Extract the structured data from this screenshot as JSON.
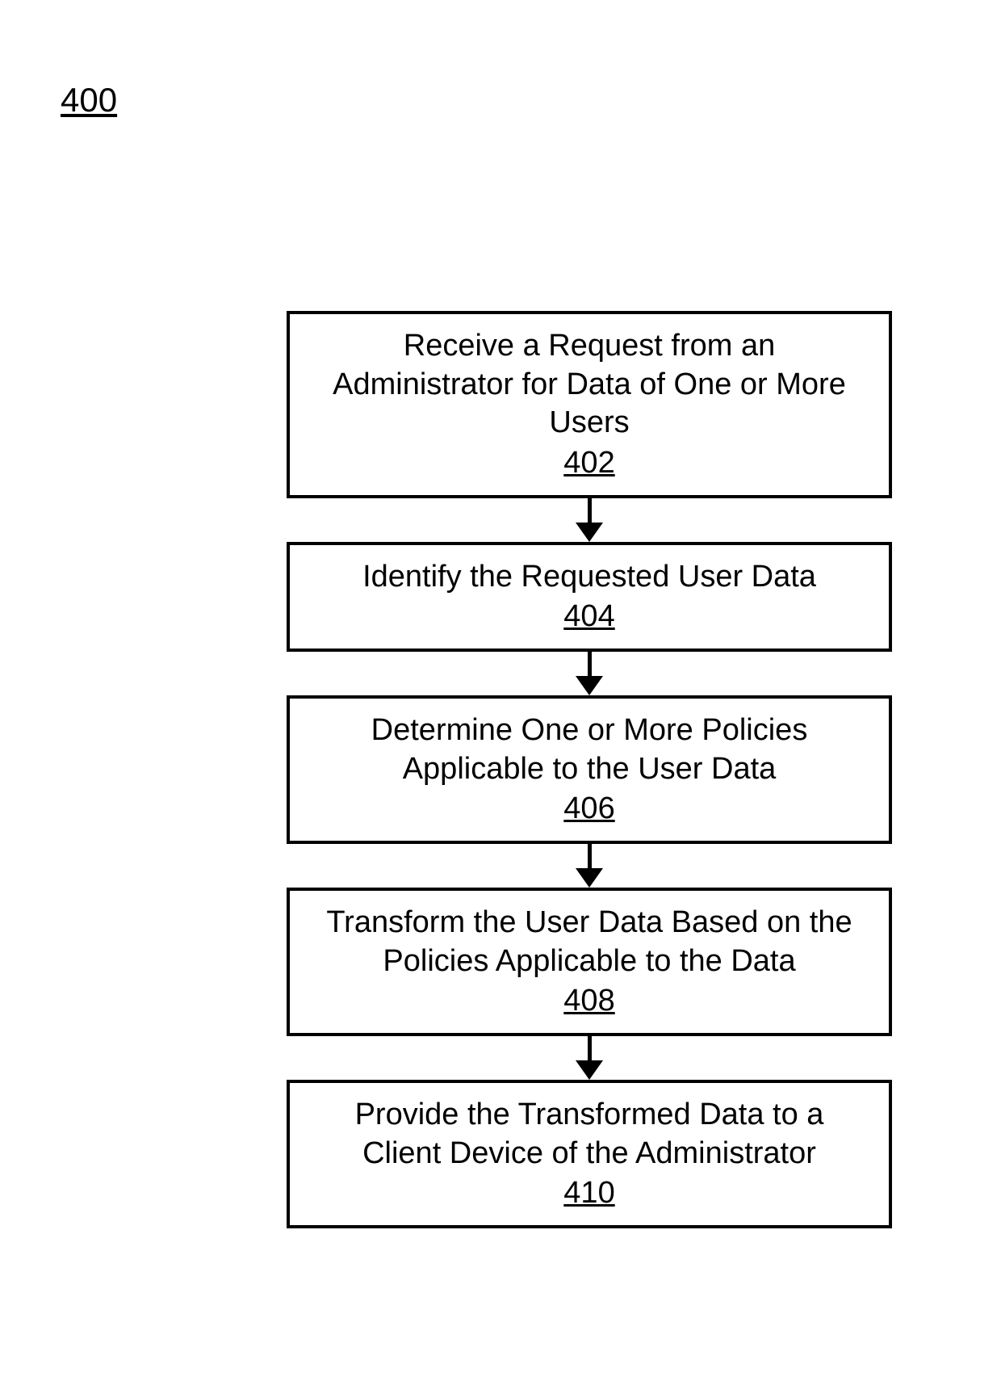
{
  "figure_number": "400",
  "steps": [
    {
      "label": "Receive a Request from an Administrator for Data of One or More Users",
      "ref": "402"
    },
    {
      "label": "Identify the Requested User Data",
      "ref": "404"
    },
    {
      "label": "Determine One or More Policies Applicable to the User Data",
      "ref": "406"
    },
    {
      "label": "Transform the User Data Based on the Policies Applicable to the Data",
      "ref": "408"
    },
    {
      "label": "Provide the Transformed Data to a Client Device of the Administrator",
      "ref": "410"
    }
  ]
}
